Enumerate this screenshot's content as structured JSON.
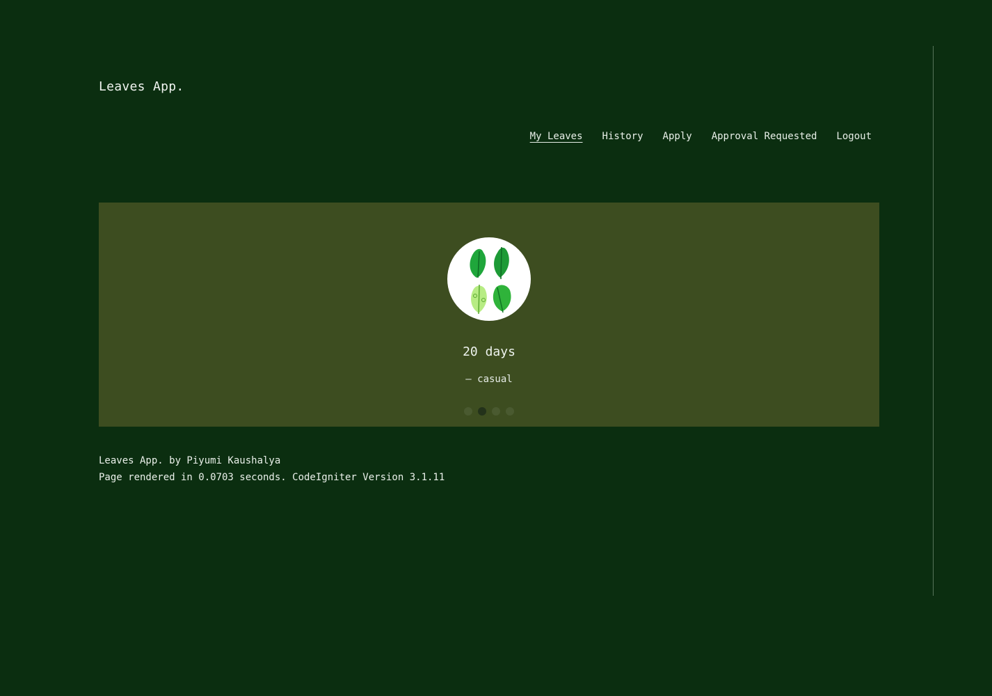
{
  "brand": "Leaves App.",
  "nav": [
    {
      "label": "My Leaves",
      "active": true
    },
    {
      "label": "History",
      "active": false
    },
    {
      "label": "Apply",
      "active": false
    },
    {
      "label": "Approval Requested",
      "active": false
    },
    {
      "label": "Logout",
      "active": false
    }
  ],
  "hero": {
    "icon": "leaves-illustration-icon",
    "days": "20 days",
    "type": "— casual",
    "slide_count": 4,
    "active_slide": 2
  },
  "footer": {
    "line1": "Leaves App. by Piyumi Kaushalya",
    "line2": "Page rendered in 0.0703 seconds. CodeIgniter Version 3.1.11"
  },
  "colors": {
    "background": "#0b2e10",
    "panel": "#3d4d20",
    "dot": "#4a5a30",
    "dot_active": "#23321a"
  }
}
